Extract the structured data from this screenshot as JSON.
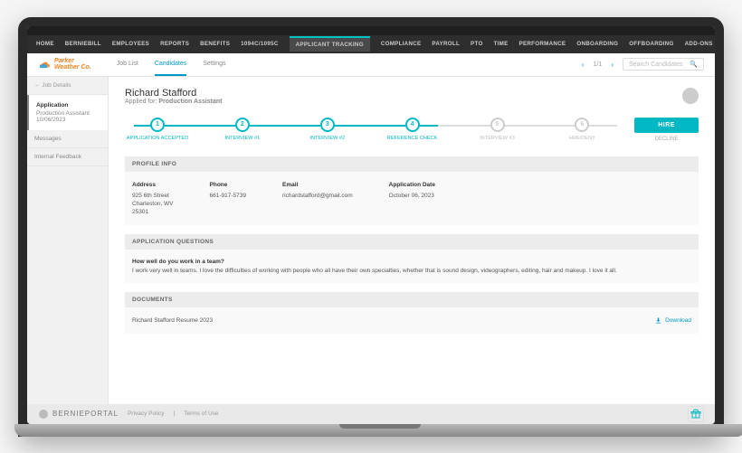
{
  "nav": {
    "items": [
      "HOME",
      "BERNIEBILL",
      "EMPLOYEES",
      "REPORTS",
      "BENEFITS",
      "1094C/1095C",
      "APPLICANT TRACKING",
      "COMPLIANCE",
      "PAYROLL",
      "PTO",
      "TIME",
      "PERFORMANCE",
      "ONBOARDING",
      "OFFBOARDING",
      "ADD-ONS"
    ],
    "active_index": 6
  },
  "brand": {
    "line1": "Parker",
    "line2": "Weather Co."
  },
  "subtabs": {
    "items": [
      "Job List",
      "Candidates",
      "Settings"
    ],
    "active_index": 1
  },
  "pager": {
    "text": "1/1"
  },
  "search": {
    "placeholder": "Search Candidates"
  },
  "sidebar": {
    "back": "Job Details",
    "block": {
      "title": "Application",
      "role": "Production Assistant",
      "date": "10/06/2023"
    },
    "links": [
      "Messages",
      "Internal Feedback"
    ]
  },
  "candidate": {
    "name": "Richard Stafford",
    "applied_for_label": "Applied for:",
    "applied_for": "Production Assistant"
  },
  "pipeline": {
    "stages": [
      {
        "num": "1",
        "label": "APPLICATION ACCEPTED",
        "active": true
      },
      {
        "num": "2",
        "label": "INTERVIEW #1",
        "active": true
      },
      {
        "num": "3",
        "label": "INTERVIEW #2",
        "active": true
      },
      {
        "num": "4",
        "label": "REFERENCE CHECK",
        "active": true
      },
      {
        "num": "5",
        "label": "INTERVIEW #3",
        "active": false
      },
      {
        "num": "6",
        "label": "HRE/DENY",
        "active": false
      }
    ],
    "hire": "HIRE",
    "decline": "DECLINE"
  },
  "sections": {
    "profile": {
      "title": "PROFILE INFO",
      "address": {
        "label": "Address",
        "line1": "925 6th Street",
        "line2": "Charleston, WV",
        "line3": "25301"
      },
      "phone": {
        "label": "Phone",
        "value": "661-917-5739"
      },
      "email": {
        "label": "Email",
        "value": "richardstafford@gmail.com"
      },
      "appdate": {
        "label": "Application Date",
        "value": "October 06, 2023"
      }
    },
    "questions": {
      "title": "APPLICATION QUESTIONS",
      "q": "How well do you work in a team?",
      "a": "I work very well in teams. I love the difficulties of working with people who all have their own specialties, whether that is sound design, videographers, editing, hair and makeup. I love it all."
    },
    "documents": {
      "title": "DOCUMENTS",
      "file": "Richard Stafford Resume 2023",
      "download": "Download"
    }
  },
  "footer": {
    "brand": "BERNIEPORTAL",
    "links": [
      "Privacy Policy",
      "Terms of Use"
    ]
  }
}
